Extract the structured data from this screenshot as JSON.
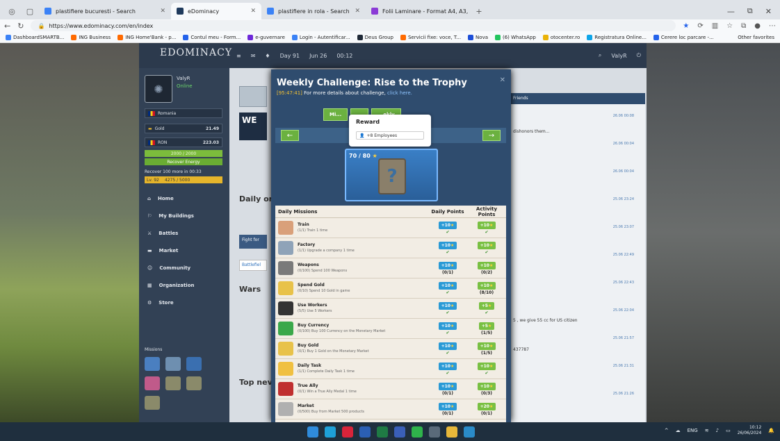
{
  "browser": {
    "tabs": [
      {
        "label": "plastifiere bucuresti - Search",
        "icon": "search-icon",
        "active": false
      },
      {
        "label": "eDominacy",
        "icon": "edominacy-favicon",
        "active": true
      },
      {
        "label": "plastifiere in rola - Search",
        "icon": "search-icon",
        "active": false
      },
      {
        "label": "Folii Laminare - Format A4, A3, A",
        "icon": "shop-favicon",
        "active": false
      }
    ],
    "url": "https://www.edominacy.com/en/index",
    "bookmarks": [
      "DashboardSMARTB...",
      "ING Business",
      "ING Home'Bank - p...",
      "Contul meu - Form...",
      "e-guvernare",
      "Login - Autentificar...",
      "Deus Group",
      "Servicii fixe: voce, T...",
      "Nova",
      "(6) WhatsApp",
      "otocenter.ro",
      "Registratura Online...",
      "Cerere loc parcare -..."
    ],
    "other_favorites": "Other favorites"
  },
  "game": {
    "logo": "EDOMINACY",
    "topnav": {
      "day": "Day 91",
      "date": "Jun 26",
      "time": "00:12",
      "user": "ValyR"
    },
    "profile": {
      "name": "ValyR",
      "status": "Online"
    },
    "country": "Romania",
    "gold": {
      "label": "Gold",
      "value": "21.49"
    },
    "ron": {
      "label": "RON",
      "value": "223.03"
    },
    "energy": "2000 / 2000",
    "recover_energy": "Recover Energy",
    "recover_note": "Recover 100 more in 00:33",
    "level": "Lv. 92",
    "xp": "4275 / 5000",
    "menu": [
      "Home",
      "My Buildings",
      "Battles",
      "Market",
      "Community",
      "Organization",
      "Store"
    ],
    "missions_label": "Missions",
    "wars_label": "Wars",
    "top_news": "Top nev",
    "friends_tab": "Friends"
  },
  "modal": {
    "title": "Weekly Challenge: Rise to the Trophy",
    "timer": "[95:47:41]",
    "subtitle": "For more details about challenge,",
    "link": "click here.",
    "tabs": [
      "Mi...",
      "...",
      "...ekly"
    ],
    "reward": {
      "title": "Reward",
      "item": "+8 Employees"
    },
    "progress": "70 / 80",
    "table_headers": [
      "Daily Missions",
      "Daily Points",
      "Activity Points"
    ],
    "missions": [
      {
        "name": "Train",
        "desc": "(1/1) Train 1 time",
        "dp": "+10",
        "ap": "+10",
        "ds": "✔",
        "as": "✔"
      },
      {
        "name": "Factory",
        "desc": "(1/1) Upgrade a company 1 time",
        "dp": "+10",
        "ap": "+10",
        "ds": "✔",
        "as": "✔"
      },
      {
        "name": "Weapons",
        "desc": "(0/100) Spend 100 Weapons",
        "dp": "+10",
        "ap": "+10",
        "ds": "(0/1)",
        "as": "(0/2)"
      },
      {
        "name": "Spend Gold",
        "desc": "(0/10) Spend 10 Gold in game",
        "dp": "+10",
        "ap": "+10",
        "ds": "✔",
        "as": "(8/10)"
      },
      {
        "name": "Use Workers",
        "desc": "(5/5) Use 5 Workers",
        "dp": "+10",
        "ap": "+5",
        "ds": "✔",
        "as": "✔"
      },
      {
        "name": "Buy Currency",
        "desc": "(0/100) Buy 100 Currency on the Monetary Market",
        "dp": "+10",
        "ap": "+5",
        "ds": "✔",
        "as": "(1/5)"
      },
      {
        "name": "Buy Gold",
        "desc": "(0/1) Buy 1 Gold on the Monetary Market",
        "dp": "+10",
        "ap": "+10",
        "ds": "✔",
        "as": "(1/5)"
      },
      {
        "name": "Daily Task",
        "desc": "(1/1) Complete Daily Task 1 time",
        "dp": "+10",
        "ap": "+10",
        "ds": "✔",
        "as": "✔"
      },
      {
        "name": "True Ally",
        "desc": "(0/1) Win a True Ally Medal 1 time",
        "dp": "+10",
        "ap": "+10",
        "ds": "(0/1)",
        "as": "(0/3)"
      },
      {
        "name": "Market",
        "desc": "(0/500) Buy from Market 500 products",
        "dp": "+10",
        "ap": "+20",
        "ds": "(0/1)",
        "as": "(0/1)"
      }
    ]
  },
  "feed_times": [
    "26.06 00:08",
    "26.06 00:04",
    "26.06 00:04",
    "25.06 23:24",
    "25.06 23:07",
    "25.06 22:49",
    "25.06 22:43",
    "25.06 22:04",
    "25.06 21:57",
    "25.06 21:31",
    "25.06 21:26"
  ],
  "feed_snippets": [
    "dishonors them...",
    "5 , we give 55 cc for US citizen",
    "437787"
  ],
  "taskbar": {
    "lang": "ENG",
    "time": "10:12",
    "date": "26/06/2024"
  }
}
